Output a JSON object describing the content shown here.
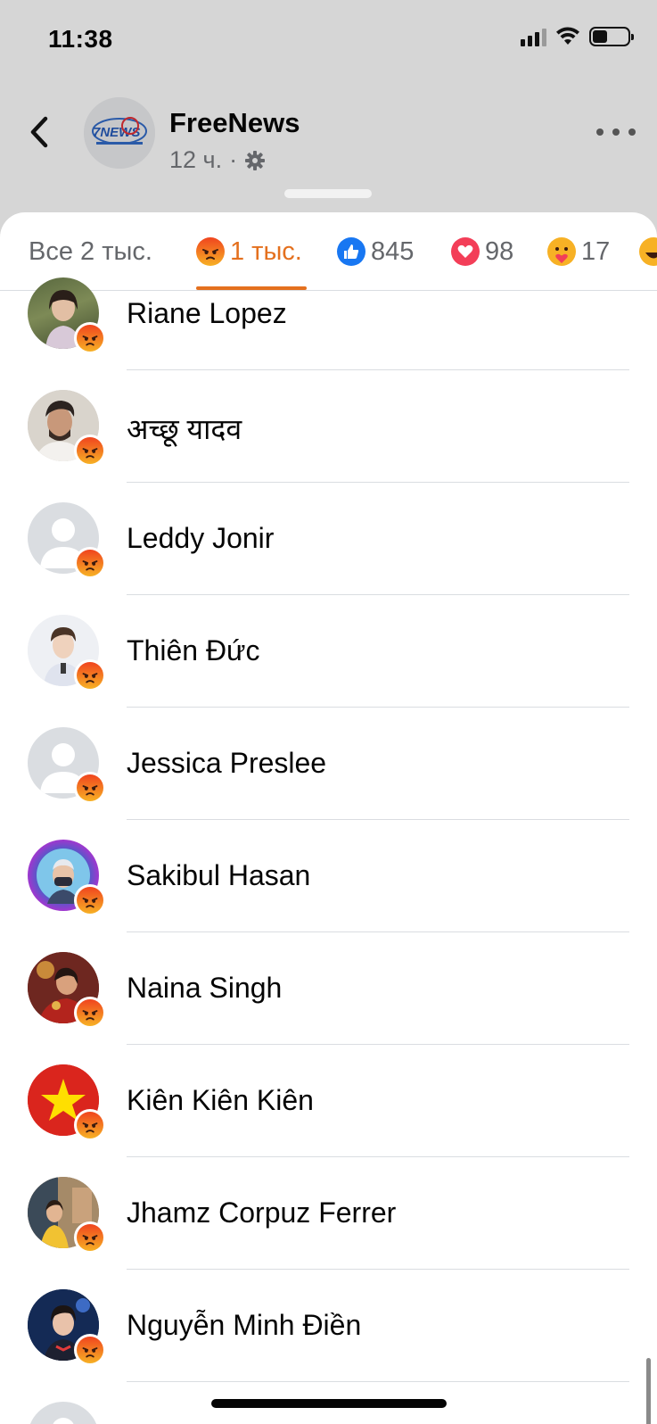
{
  "status_bar": {
    "time": "11:38"
  },
  "header": {
    "page_name": "FreeNews",
    "post_time": "12 ч.",
    "separator": "·",
    "avatar_text": "7NEWS"
  },
  "tabs": [
    {
      "id": "all",
      "label": "Все 2 тыс.",
      "active": false
    },
    {
      "id": "angry",
      "label": "1 тыс.",
      "active": true,
      "icon": "angry-icon"
    },
    {
      "id": "like",
      "label": "845",
      "active": false,
      "icon": "like-icon"
    },
    {
      "id": "love",
      "label": "98",
      "active": false,
      "icon": "love-icon"
    },
    {
      "id": "care",
      "label": "17",
      "active": false,
      "icon": "care-icon"
    },
    {
      "id": "haha",
      "label": "",
      "active": false,
      "icon": "haha-icon"
    }
  ],
  "reactors": [
    {
      "name": "Riane Lopez",
      "reaction": "angry"
    },
    {
      "name": "अच्छू यादव",
      "reaction": "angry"
    },
    {
      "name": "Leddy Jonir",
      "reaction": "angry"
    },
    {
      "name": "Thiên Đức",
      "reaction": "angry"
    },
    {
      "name": "Jessica Preslee",
      "reaction": "angry"
    },
    {
      "name": "Sakibul Hasan",
      "reaction": "angry"
    },
    {
      "name": "Naina Singh",
      "reaction": "angry"
    },
    {
      "name": "Kiên Kiên Kiên",
      "reaction": "angry"
    },
    {
      "name": "Jhamz Corpuz Ferrer",
      "reaction": "angry"
    },
    {
      "name": "Nguyễn Minh Điền",
      "reaction": "angry"
    }
  ],
  "colors": {
    "accent_angry": "#e4701e",
    "like_blue": "#1877f2",
    "love_red": "#f33e58",
    "text_secondary": "#65676b"
  }
}
